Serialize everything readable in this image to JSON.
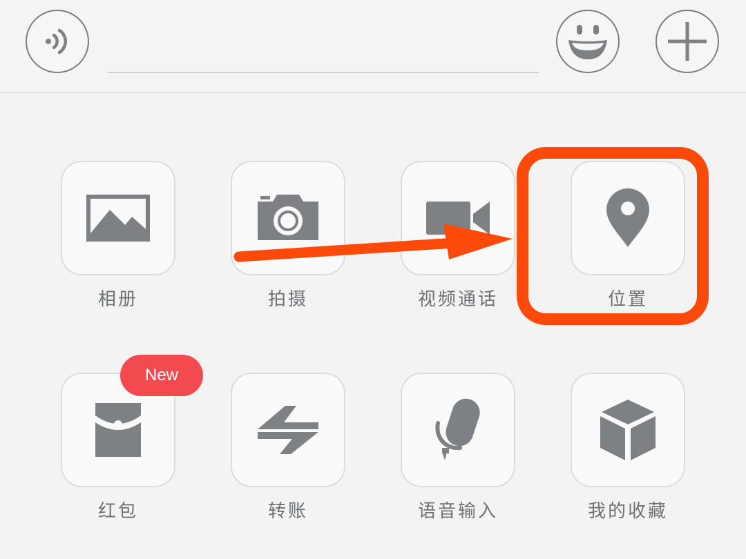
{
  "input": {
    "value": "",
    "placeholder": ""
  },
  "grid": {
    "items": [
      {
        "label": "相册",
        "icon": "image-icon"
      },
      {
        "label": "拍摄",
        "icon": "camera-icon"
      },
      {
        "label": "视频通话",
        "icon": "video-camera-icon"
      },
      {
        "label": "位置",
        "icon": "location-pin-icon"
      },
      {
        "label": "红包",
        "icon": "red-packet-icon"
      },
      {
        "label": "转账",
        "icon": "transfer-icon"
      },
      {
        "label": "语音输入",
        "icon": "microphone-icon"
      },
      {
        "label": "我的收藏",
        "icon": "cube-icon"
      }
    ]
  },
  "badge": {
    "text": "New"
  },
  "colors": {
    "icon": "#7d8184",
    "highlight": "#fc4a0b",
    "badge": "#f24a4e"
  }
}
